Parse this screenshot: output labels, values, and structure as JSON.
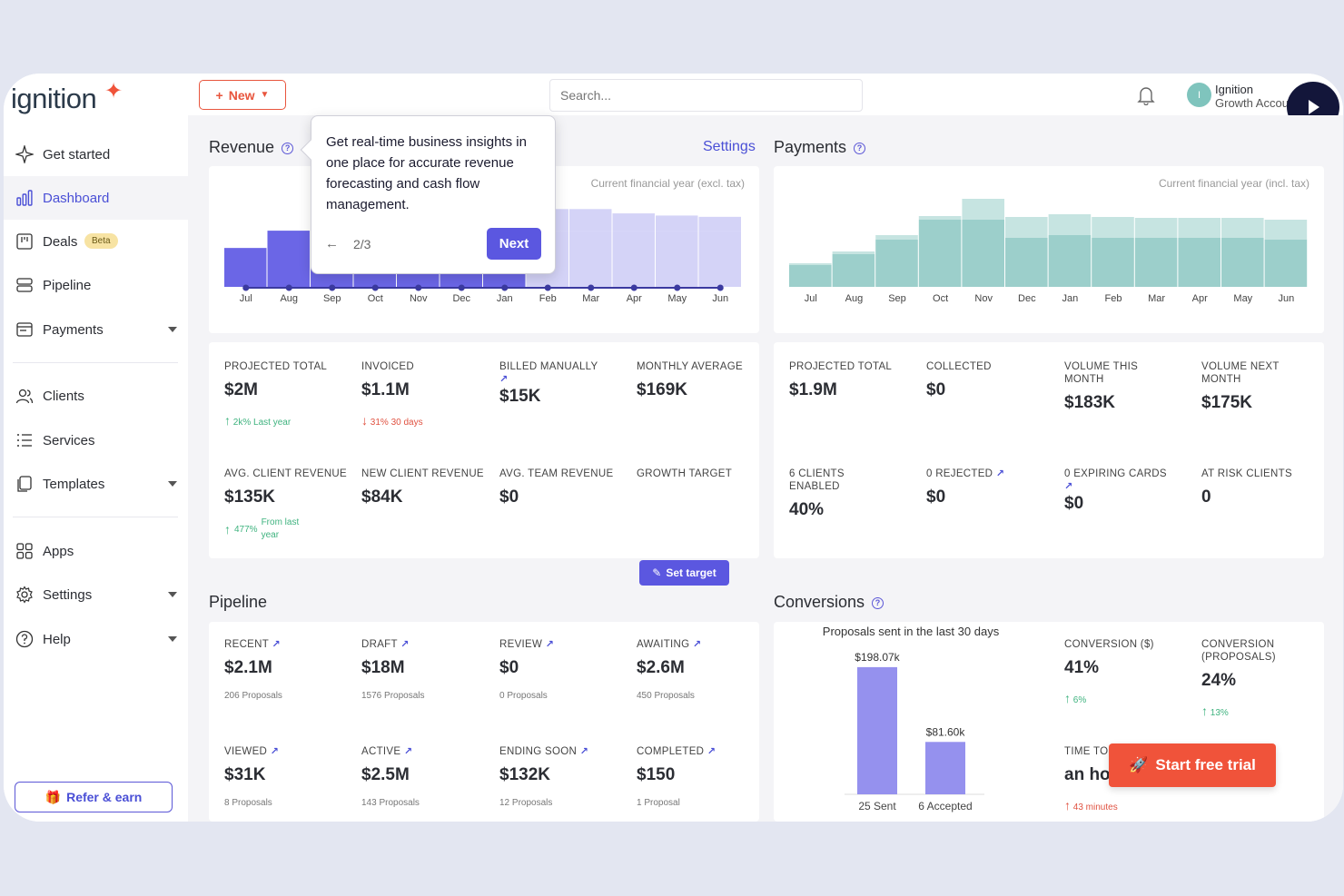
{
  "brand": {
    "logo_text": "ignition",
    "accent": "#f0533a",
    "primary": "#5b57e0"
  },
  "sidebar": {
    "items": [
      {
        "label": "Get started",
        "icon": "sparkle-icon"
      },
      {
        "label": "Dashboard",
        "icon": "bar-chart-icon",
        "active": true
      },
      {
        "label": "Deals",
        "icon": "kanban-icon",
        "badge": "Beta"
      },
      {
        "label": "Pipeline",
        "icon": "stack-icon"
      },
      {
        "label": "Payments",
        "icon": "wallet-icon"
      },
      {
        "label": "Clients",
        "icon": "users-icon"
      },
      {
        "label": "Services",
        "icon": "list-icon"
      },
      {
        "label": "Templates",
        "icon": "document-icon"
      },
      {
        "label": "Apps",
        "icon": "grid-icon"
      },
      {
        "label": "Settings",
        "icon": "gear-icon"
      },
      {
        "label": "Help",
        "icon": "help-icon"
      }
    ],
    "refer_label": "Refer & earn"
  },
  "topbar": {
    "new_label": "New",
    "search_placeholder": "Search...",
    "user_initial": "I",
    "user_name": "Ignition",
    "user_role": "Growth Account"
  },
  "tooltip": {
    "text": "Get real-time business insights in one place for accurate revenue forecasting and cash flow management.",
    "step": "2/3",
    "next_label": "Next"
  },
  "revenue": {
    "title": "Revenue",
    "settings_label": "Settings",
    "caption": "Current financial year (excl. tax)",
    "metrics": [
      {
        "label": "PROJECTED TOTAL",
        "value": "$2M",
        "trend": "2k%",
        "trend_note": "Last year",
        "dir": "up"
      },
      {
        "label": "INVOICED",
        "value": "$1.1M",
        "trend": "31%",
        "trend_note": "30 days",
        "dir": "down"
      },
      {
        "label": "BILLED MANUALLY",
        "value": "$15K",
        "link": "↗"
      },
      {
        "label": "MONTHLY AVERAGE",
        "value": "$169K"
      },
      {
        "label": "AVG. CLIENT REVENUE",
        "value": "$135K",
        "trend": "477%",
        "trend_note": "From last year",
        "dir": "up"
      },
      {
        "label": "NEW CLIENT REVENUE",
        "value": "$84K"
      },
      {
        "label": "AVG. TEAM REVENUE",
        "value": "$0"
      },
      {
        "label": "GROWTH TARGET",
        "button": "Set target"
      }
    ]
  },
  "payments": {
    "title": "Payments",
    "caption": "Current financial year (incl. tax)",
    "metrics": [
      {
        "label": "PROJECTED TOTAL",
        "value": "$1.9M"
      },
      {
        "label": "COLLECTED",
        "value": "$0"
      },
      {
        "label": "VOLUME THIS MONTH",
        "value": "$183K"
      },
      {
        "label": "VOLUME NEXT MONTH",
        "value": "$175K"
      },
      {
        "label": "6 CLIENTS ENABLED",
        "value": "40%"
      },
      {
        "label": "0 REJECTED",
        "value": "$0",
        "link": "↗"
      },
      {
        "label": "0 EXPIRING CARDS",
        "value": "$0",
        "link": "↗"
      },
      {
        "label": "AT RISK CLIENTS",
        "value": "0"
      }
    ]
  },
  "pipeline": {
    "title": "Pipeline",
    "metrics": [
      {
        "label": "RECENT",
        "value": "$2.1M",
        "sub": "206 Proposals"
      },
      {
        "label": "DRAFT",
        "value": "$18M",
        "sub": "1576 Proposals"
      },
      {
        "label": "REVIEW",
        "value": "$0",
        "sub": "0 Proposals"
      },
      {
        "label": "AWAITING",
        "value": "$2.6M",
        "sub": "450 Proposals"
      },
      {
        "label": "VIEWED",
        "value": "$31K",
        "sub": "8 Proposals"
      },
      {
        "label": "ACTIVE",
        "value": "$2.5M",
        "sub": "143 Proposals"
      },
      {
        "label": "ENDING SOON",
        "value": "$132K",
        "sub": "12 Proposals"
      },
      {
        "label": "COMPLETED",
        "value": "$150",
        "sub": "1 Proposal"
      }
    ]
  },
  "conversions": {
    "title": "Conversions",
    "metrics": [
      {
        "label": "CONVERSION ($)",
        "value": "41%",
        "trend": "6%"
      },
      {
        "label": "CONVERSION (PROPOSALS)",
        "value": "24%",
        "trend": "13%"
      },
      {
        "label": "TIME TO",
        "value": "an ho",
        "trend": "43 minutes"
      }
    ],
    "trial_label": "Start free trial"
  },
  "chart_data": [
    {
      "type": "bar",
      "categories": [
        "Jul",
        "Aug",
        "Sep",
        "Oct",
        "Nov",
        "Dec",
        "Jan",
        "Feb",
        "Mar",
        "Apr",
        "May",
        "Jun"
      ],
      "series": [
        {
          "values": [
            0.9,
            1.3,
            1.3,
            1.3,
            1.3,
            1.3,
            1.3,
            1.3,
            1.3,
            1.3,
            1.3,
            1.3
          ]
        },
        {
          "values": [
            0,
            0,
            0,
            0,
            0,
            0,
            0,
            0.5,
            0.5,
            0.4,
            0.35,
            0.32
          ]
        }
      ],
      "ylim": [
        0,
        2.1
      ],
      "grid": false
    },
    {
      "type": "bar",
      "categories": [
        "Jul",
        "Aug",
        "Sep",
        "Oct",
        "Nov",
        "Dec",
        "Jan",
        "Feb",
        "Mar",
        "Apr",
        "May",
        "Jun"
      ],
      "series": [
        {
          "values": [
            0.24,
            0.36,
            0.52,
            0.74,
            0.74,
            0.54,
            0.57,
            0.54,
            0.54,
            0.54,
            0.54,
            0.52
          ]
        },
        {
          "values": [
            0.02,
            0.03,
            0.05,
            0.04,
            0.23,
            0.23,
            0.23,
            0.23,
            0.22,
            0.22,
            0.22,
            0.22
          ]
        }
      ],
      "ylim": [
        0,
        1.0
      ],
      "caption": "Current financial year (incl. tax)",
      "grid": false
    },
    {
      "type": "bar",
      "title": "Proposals sent in the last 30 days",
      "categories": [
        "25 Sent",
        "6 Accepted"
      ],
      "values": [
        198.07,
        81.6
      ],
      "value_labels": [
        "$198.07k",
        "$81.60k"
      ],
      "ylim": [
        0,
        205
      ],
      "grid": false
    }
  ]
}
